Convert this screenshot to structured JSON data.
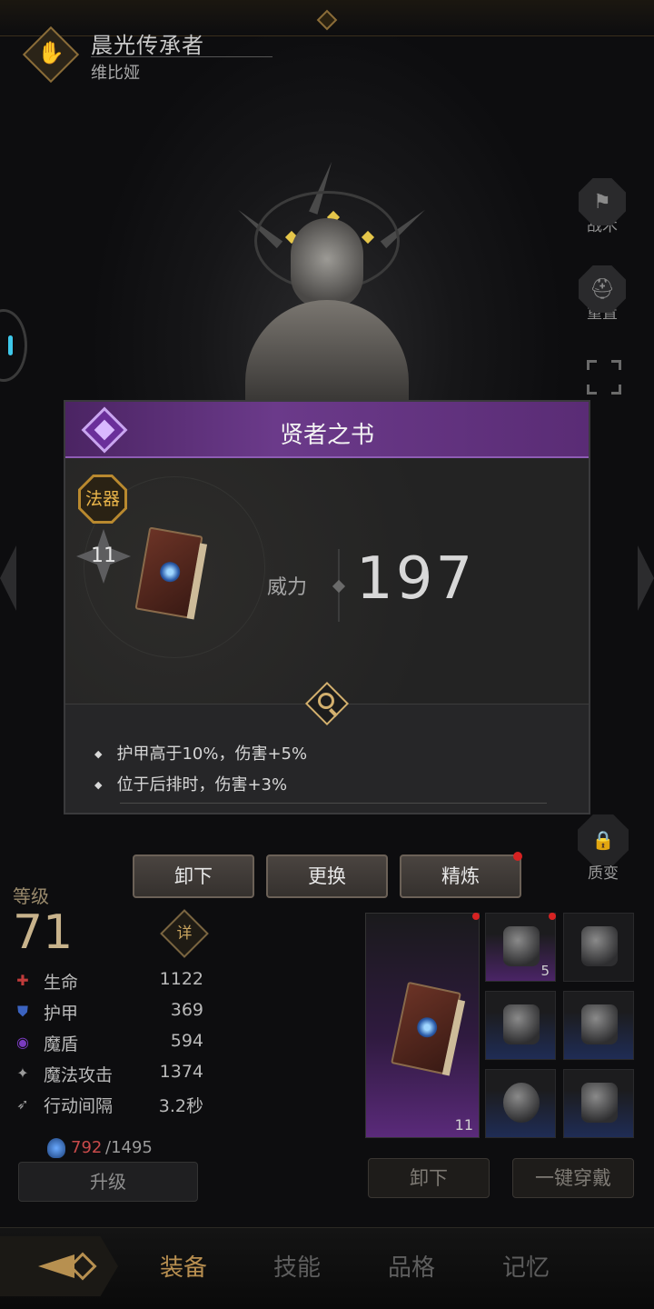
{
  "header": {
    "character_title": "晨光传承者",
    "character_name": "维比娅"
  },
  "side_buttons": {
    "tactics": "战术",
    "reset": "重置",
    "quality_change": "质变"
  },
  "item_popup": {
    "name": "贤者之书",
    "rarity_color": "#6b3a8a",
    "type_label": "法器",
    "level": "11",
    "power_label": "威力",
    "power_value": "197",
    "effects": [
      "护甲高于10%，伤害+5%",
      "位于后排时，伤害+3%"
    ]
  },
  "actions": {
    "unequip": "卸下",
    "replace": "更换",
    "refine": "精炼"
  },
  "stats": {
    "level_label": "等级",
    "level_value": "71",
    "detail_label": "详",
    "rows": [
      {
        "icon": "health-cross-icon",
        "name": "生命",
        "value": "1122",
        "color": "#c03b3b"
      },
      {
        "icon": "shield-icon",
        "name": "护甲",
        "value": "369",
        "color": "#3b63c0"
      },
      {
        "icon": "magic-shield-icon",
        "name": "魔盾",
        "value": "594",
        "color": "#7a3bc0"
      },
      {
        "icon": "magic-attack-icon",
        "name": "魔法攻击",
        "value": "1374",
        "color": "#9a9a9a"
      },
      {
        "icon": "wing-icon",
        "name": "行动间隔",
        "value": "3.2秒",
        "color": "#9a9a9a"
      }
    ],
    "exp_current": "792",
    "exp_max": "/1495",
    "upgrade_label": "升级"
  },
  "equipment": {
    "weapon_level": "11",
    "helmet_count": "5",
    "unequip_label": "卸下",
    "one_click_label": "一键穿戴"
  },
  "bottom_nav": {
    "tabs": [
      "装备",
      "技能",
      "品格",
      "记忆"
    ],
    "active_index": 0
  }
}
